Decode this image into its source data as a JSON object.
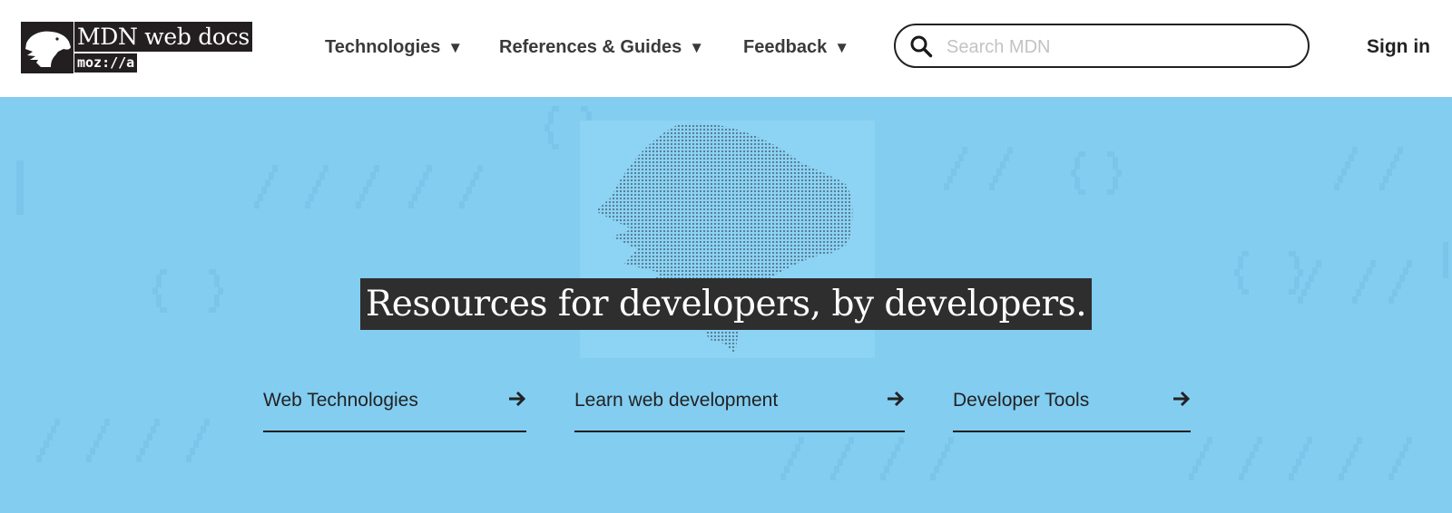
{
  "logo": {
    "title": "MDN web docs",
    "subtitle": "moz://a",
    "icon": "dinosaur-head-icon"
  },
  "nav": {
    "items": [
      {
        "label": "Technologies",
        "caret": "▼"
      },
      {
        "label": "References & Guides",
        "caret": "▼"
      },
      {
        "label": "Feedback",
        "caret": "▼"
      }
    ]
  },
  "search": {
    "placeholder": "Search MDN",
    "value": "",
    "icon": "search-icon"
  },
  "header": {
    "signin_label": "Sign in"
  },
  "hero": {
    "tagline": "Resources for developers, by developers.",
    "links": [
      {
        "label": "Web Technologies",
        "icon": "arrow-right-icon"
      },
      {
        "label": "Learn web development",
        "icon": "arrow-right-icon"
      },
      {
        "label": "Developer Tools",
        "icon": "arrow-right-icon"
      }
    ]
  },
  "colors": {
    "hero_background": "#83cdf1",
    "logo_background": "#231f20",
    "tagline_background": "#2e2e2e",
    "text": "#333333"
  }
}
